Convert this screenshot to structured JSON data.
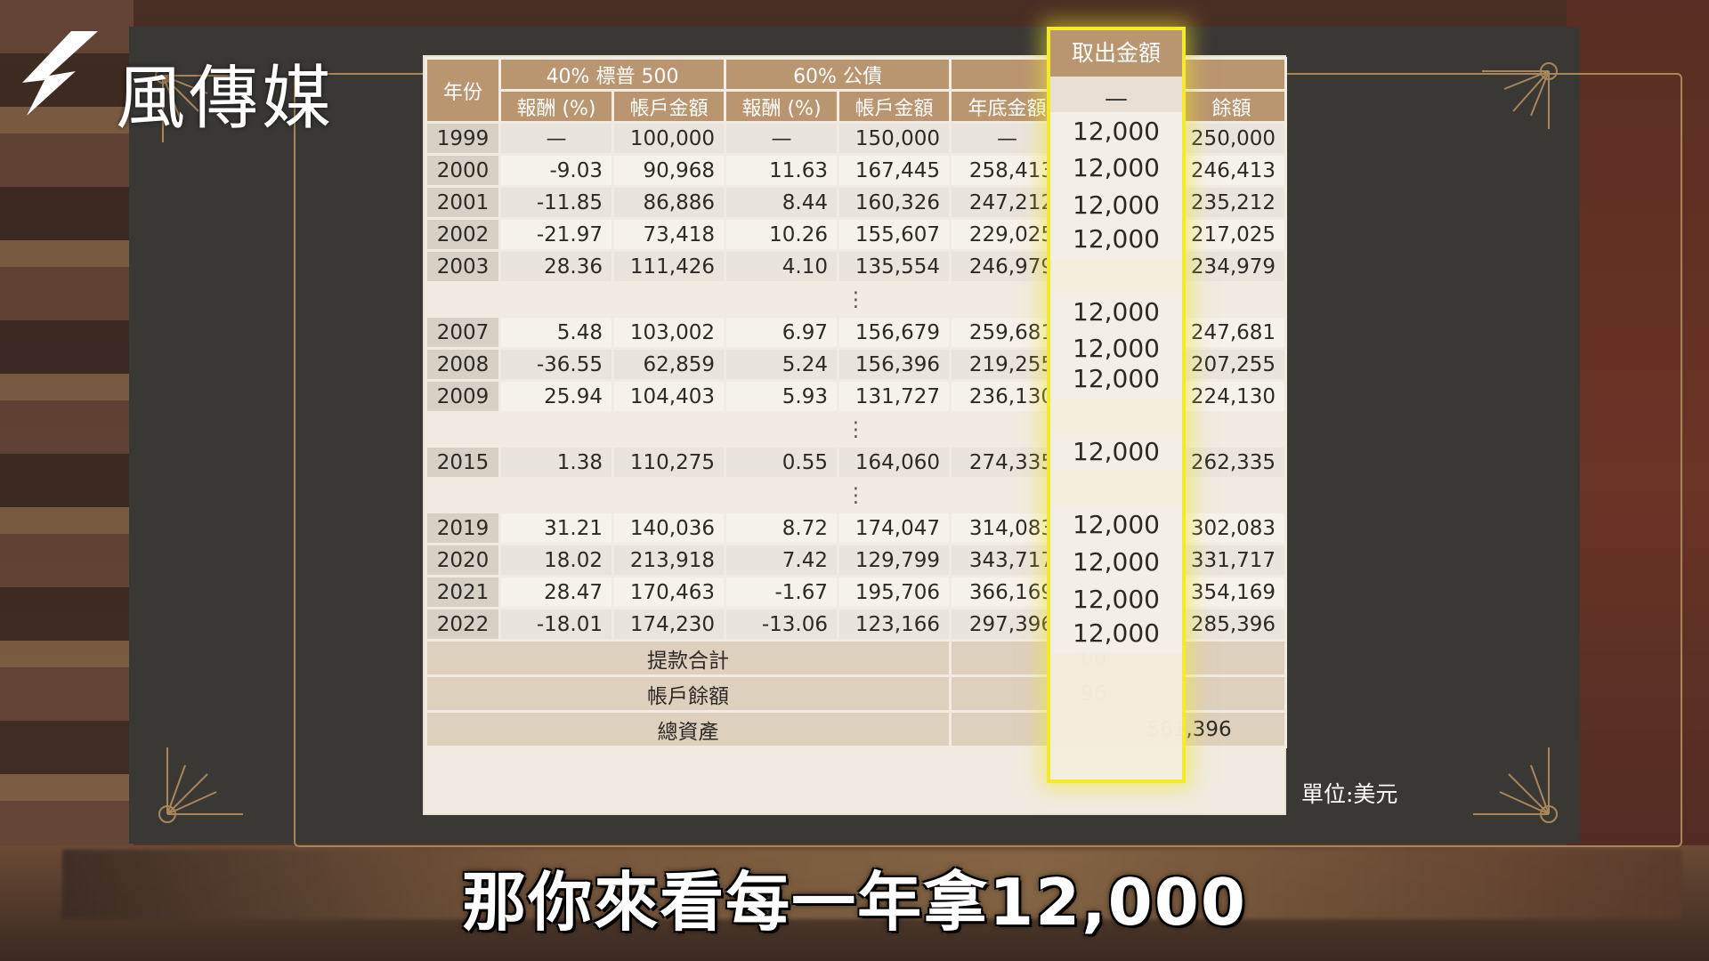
{
  "brand": {
    "name": "風傳媒"
  },
  "table": {
    "header": {
      "year": "年份",
      "sp500": "40% 標普 500",
      "bonds": "60% 公債",
      "return_pct": "報酬 (%)",
      "account_amount": "帳戶金額",
      "year_end_total": "年底金額",
      "balance": "餘額"
    },
    "rows": [
      {
        "year": "1999",
        "sp_ret": "—",
        "sp_amt": "100,000",
        "bd_ret": "—",
        "bd_amt": "150,000",
        "total": "—",
        "balance": "250,000"
      },
      {
        "year": "2000",
        "sp_ret": "-9.03",
        "sp_amt": "90,968",
        "bd_ret": "11.63",
        "bd_amt": "167,445",
        "total": "258,413",
        "balance": "246,413"
      },
      {
        "year": "2001",
        "sp_ret": "-11.85",
        "sp_amt": "86,886",
        "bd_ret": "8.44",
        "bd_amt": "160,326",
        "total": "247,212",
        "balance": "235,212"
      },
      {
        "year": "2002",
        "sp_ret": "-21.97",
        "sp_amt": "73,418",
        "bd_ret": "10.26",
        "bd_amt": "155,607",
        "total": "229,025",
        "balance": "217,025"
      },
      {
        "year": "2003",
        "sp_ret": "28.36",
        "sp_amt": "111,426",
        "bd_ret": "4.10",
        "bd_amt": "135,554",
        "total": "246,979",
        "balance": "234,979"
      },
      {
        "year": "2007",
        "sp_ret": "5.48",
        "sp_amt": "103,002",
        "bd_ret": "6.97",
        "bd_amt": "156,679",
        "total": "259,681",
        "balance": "247,681"
      },
      {
        "year": "2008",
        "sp_ret": "-36.55",
        "sp_amt": "62,859",
        "bd_ret": "5.24",
        "bd_amt": "156,396",
        "total": "219,255",
        "balance": "207,255"
      },
      {
        "year": "2009",
        "sp_ret": "25.94",
        "sp_amt": "104,403",
        "bd_ret": "5.93",
        "bd_amt": "131,727",
        "total": "236,130",
        "balance": "224,130"
      },
      {
        "year": "2015",
        "sp_ret": "1.38",
        "sp_amt": "110,275",
        "bd_ret": "0.55",
        "bd_amt": "164,060",
        "total": "274,335",
        "balance": "262,335"
      },
      {
        "year": "2019",
        "sp_ret": "31.21",
        "sp_amt": "140,036",
        "bd_ret": "8.72",
        "bd_amt": "174,047",
        "total": "314,083",
        "balance": "302,083"
      },
      {
        "year": "2020",
        "sp_ret": "18.02",
        "sp_amt": "213,918",
        "bd_ret": "7.42",
        "bd_amt": "129,799",
        "total": "343,717",
        "balance": "331,717"
      },
      {
        "year": "2021",
        "sp_ret": "28.47",
        "sp_amt": "170,463",
        "bd_ret": "-1.67",
        "bd_amt": "195,706",
        "total": "366,169",
        "balance": "354,169"
      },
      {
        "year": "2022",
        "sp_ret": "-18.01",
        "sp_amt": "174,230",
        "bd_ret": "-13.06",
        "bd_amt": "123,166",
        "total": "297,396",
        "balance": "285,396"
      }
    ],
    "ellipsis": "⋮",
    "totals": {
      "withdraw_total_label": "提款合計",
      "withdraw_total_value": "00",
      "account_balance_label": "帳戶餘額",
      "account_balance_value": "96",
      "total_assets_label": "總資產",
      "total_assets_value": "561,396"
    }
  },
  "highlight": {
    "header": "取出金額",
    "dash": "—",
    "values": [
      "12,000",
      "12,000",
      "12,000",
      "12,000",
      "12,000",
      "12,000",
      "12,000",
      "12,000",
      "12,000",
      "12,000",
      "12,000",
      "12,000"
    ],
    "color": "#f4e92a"
  },
  "unit_note": "單位:美元",
  "subtitle": "那你來看每一年拿12,000"
}
